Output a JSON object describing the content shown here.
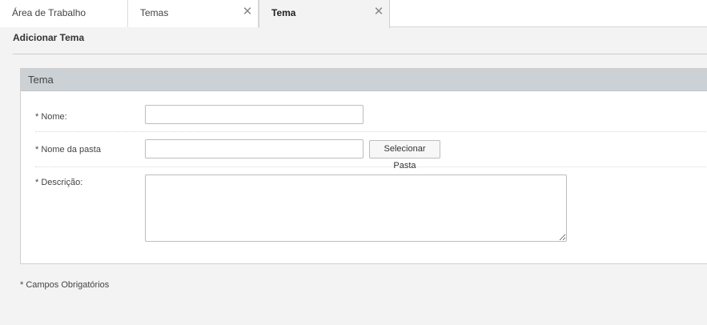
{
  "tabs": [
    {
      "label": "Área de Trabalho",
      "closable": false
    },
    {
      "label": "Temas",
      "closable": true
    },
    {
      "label": "Tema",
      "closable": true,
      "active": true
    }
  ],
  "tab_close_glyph": "✕",
  "page": {
    "title": "Adicionar Tema"
  },
  "panel": {
    "title": "Tema",
    "fields": {
      "nome": {
        "label": "* Nome:",
        "value": ""
      },
      "pasta": {
        "label": "* Nome da pasta",
        "value": "",
        "button_label": "Selecionar Pasta"
      },
      "descricao": {
        "label": "* Descrição:",
        "value": ""
      }
    }
  },
  "footnote": "* Campos Obrigatórios",
  "colors": {
    "panel_header_bg": "#ccd1d6",
    "page_bg": "#f3f3f3"
  }
}
